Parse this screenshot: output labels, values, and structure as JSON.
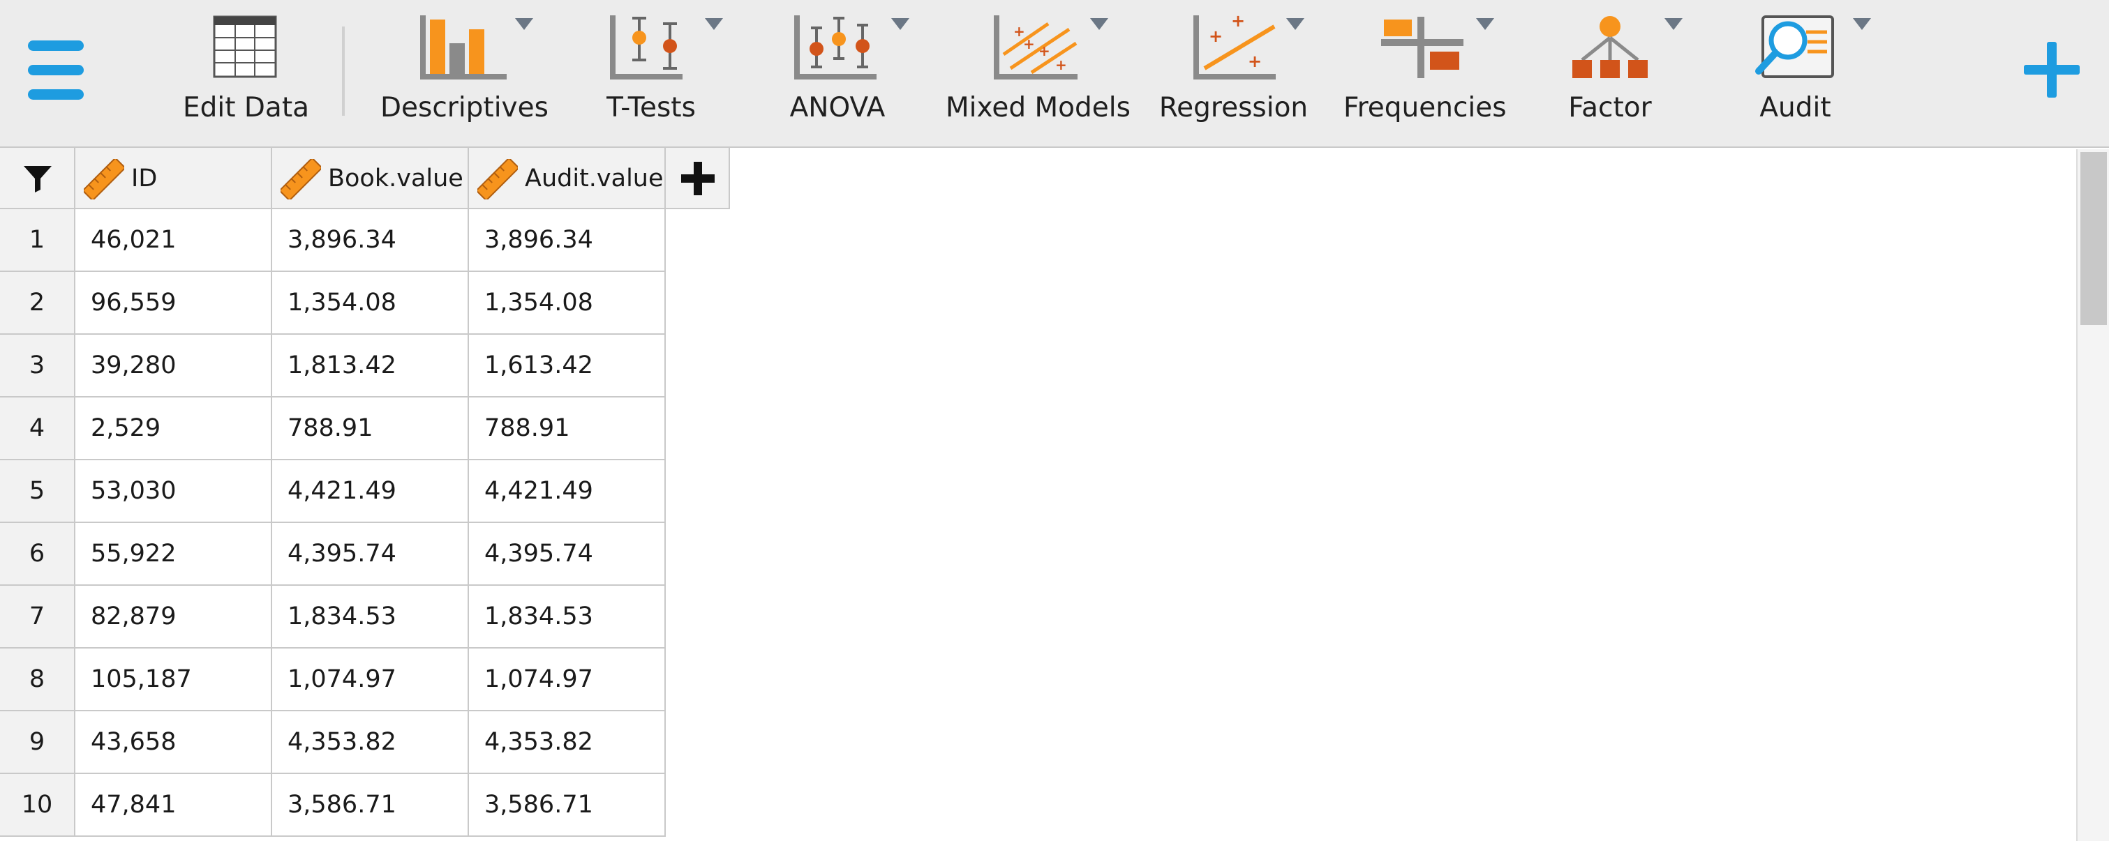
{
  "colors": {
    "accent": "#1e9ce0",
    "orange": "#f7941d",
    "dark_orange": "#d2541a",
    "gray": "#8a8a8a",
    "toolbar_bg": "#ececec"
  },
  "toolbar": {
    "menu_icon": "hamburger-menu-icon",
    "add_icon": "plus-icon",
    "items": [
      {
        "label": "Edit Data",
        "icon": "spreadsheet-icon"
      },
      {
        "label": "Descriptives",
        "icon": "bar-chart-icon"
      },
      {
        "label": "T-Tests",
        "icon": "ttest-icon"
      },
      {
        "label": "ANOVA",
        "icon": "anova-icon"
      },
      {
        "label": "Mixed Models",
        "icon": "mixed-models-icon"
      },
      {
        "label": "Regression",
        "icon": "regression-icon"
      },
      {
        "label": "Frequencies",
        "icon": "frequencies-icon"
      },
      {
        "label": "Factor",
        "icon": "factor-icon"
      },
      {
        "label": "Audit",
        "icon": "audit-icon"
      }
    ]
  },
  "table": {
    "columns": [
      {
        "name": "ID",
        "type_icon": "scale-ruler-icon"
      },
      {
        "name": "Book.value",
        "type_icon": "scale-ruler-icon"
      },
      {
        "name": "Audit.value",
        "type_icon": "scale-ruler-icon"
      }
    ],
    "rows": [
      {
        "n": "1",
        "cells": [
          "46,021",
          "3,896.34",
          "3,896.34"
        ]
      },
      {
        "n": "2",
        "cells": [
          "96,559",
          "1,354.08",
          "1,354.08"
        ]
      },
      {
        "n": "3",
        "cells": [
          "39,280",
          "1,813.42",
          "1,613.42"
        ]
      },
      {
        "n": "4",
        "cells": [
          "2,529",
          "788.91",
          "788.91"
        ]
      },
      {
        "n": "5",
        "cells": [
          "53,030",
          "4,421.49",
          "4,421.49"
        ]
      },
      {
        "n": "6",
        "cells": [
          "55,922",
          "4,395.74",
          "4,395.74"
        ]
      },
      {
        "n": "7",
        "cells": [
          "82,879",
          "1,834.53",
          "1,834.53"
        ]
      },
      {
        "n": "8",
        "cells": [
          "105,187",
          "1,074.97",
          "1,074.97"
        ]
      },
      {
        "n": "9",
        "cells": [
          "43,658",
          "4,353.82",
          "4,353.82"
        ]
      },
      {
        "n": "10",
        "cells": [
          "47,841",
          "3,586.71",
          "3,586.71"
        ]
      }
    ]
  }
}
